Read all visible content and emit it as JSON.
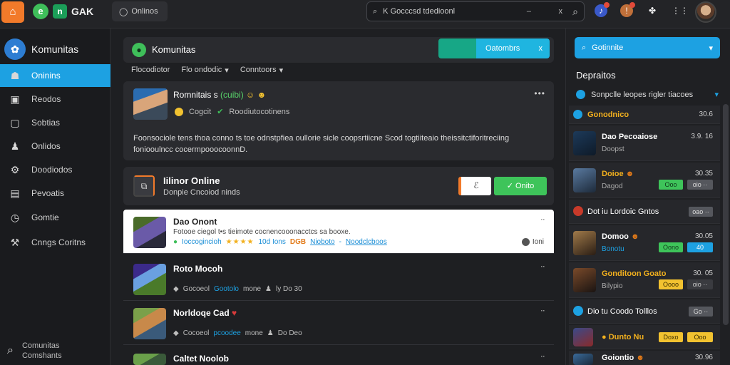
{
  "topbar": {
    "logo_glyph": "⌂",
    "brand_badge": "e",
    "brand_n": "n",
    "brand_name": "GAK",
    "tab_label": "Onlinos",
    "search_value": "K Gocccsd tdedioonl",
    "search_clear": "x",
    "search_dash": "–",
    "search_icon": "search-icon",
    "icons": [
      "notification-icon",
      "alert-icon",
      "puzzle-icon",
      "grid-icon"
    ]
  },
  "sidebar": {
    "title": "Komunitas",
    "items": [
      {
        "label": "Oninins",
        "icon": "home-icon"
      },
      {
        "label": "Reodos",
        "icon": "book-icon"
      },
      {
        "label": "Sobtias",
        "icon": "square-icon"
      },
      {
        "label": "Onlidos",
        "icon": "user-icon"
      },
      {
        "label": "Doodiodos",
        "icon": "settings-icon"
      },
      {
        "label": "Pevoatis",
        "icon": "doc-icon"
      },
      {
        "label": "Gomtie",
        "icon": "clock-icon"
      },
      {
        "label": "Cnngs Coritns",
        "icon": "wrench-icon"
      }
    ],
    "footer_lines": [
      "Comunitas",
      "Comshants"
    ]
  },
  "main": {
    "header_title": "Komunitas",
    "join_label": "Oatombrs",
    "join_close": "x",
    "filters": [
      "Flocodiotor",
      "Flo ondodic",
      "Conntoors"
    ],
    "post": {
      "title": "Romnitais s",
      "title_tag": "(cuibi)",
      "title_emoji": "☺ ☻",
      "sub_left": "Cogcit",
      "sub_right": "Roodiutocotinens",
      "body_line1": "Foonsociole tens thoa conno ts toe odnstpfiea oullorie sicle coopsrtiicne Scod togtiiteaio theissitctiforitreciing",
      "body_line2": "foniooulncc cocermpooocoonnD.",
      "kebab": "•••"
    },
    "online": {
      "title": "Iilinor Online",
      "subtitle": "Donpie Cncoiod ninds",
      "white_btn": "ℰ",
      "green_btn": "✓ Onito"
    },
    "rows": [
      {
        "name": "Dao Onont",
        "desc": "Fotooe ciegol t•s tieimote cocnencooonacctcs sa booxe.",
        "meta_left": "Ioccogincioh",
        "stars": "★★★★",
        "num": "10d Ions",
        "orange": "DGB",
        "link1": "Nioboto",
        "link2": "Noodclcboos",
        "time": "Ioni",
        "kebab": "⠒"
      },
      {
        "name": "Roto Mocoh",
        "meta_left": "Gocoeol",
        "meta_blue": "Gootolo",
        "meta_mid": "mone",
        "meta_right": "ly Do 30",
        "kebab": "⠒"
      },
      {
        "name": "Norldoqe Cad",
        "meta_left": "Cocoeol",
        "meta_blue": "pcoodee",
        "meta_mid": "mone",
        "meta_right": "Do Deo",
        "kebab": "⠒"
      },
      {
        "name": "Caltet Noolob",
        "kebab": "⠒"
      }
    ]
  },
  "right": {
    "search_label": "Gotinnite",
    "head": "Depraitos",
    "sub": "Sonpclle leopes rigler tiacoes",
    "items": [
      {
        "name": "Gonodnico",
        "val": "30.6",
        "sub": "",
        "pill": ""
      },
      {
        "name": "Dao Pecoaiose",
        "sub": "Doopst",
        "val": "3.9. 16",
        "pill": ""
      },
      {
        "name": "Doioe",
        "sub": "Dagod",
        "val": "30.35",
        "pill": "Ooo",
        "pill2": "oio ··"
      },
      {
        "name": "Dot iu Lordoic Gntos",
        "sub": "",
        "val": "",
        "pill": "oao ··"
      },
      {
        "name": "Domoo",
        "sub": "Bonotu",
        "val": "30.05",
        "pill": "Oono",
        "pill2": "40"
      },
      {
        "name": "Gonditoon Goato",
        "sub": "Bilypio",
        "val": "30. 05",
        "pill": "Oooo",
        "pill2": "oio ··"
      },
      {
        "name": "Dio tu Coodo Tolllos",
        "sub": "",
        "val": "",
        "pill": "Go ··"
      },
      {
        "name": "Dunto Nu",
        "sub": "",
        "val": "",
        "pill": "Doxo",
        "pill2": "Ooo"
      },
      {
        "name": "Goiontio",
        "sub": "",
        "val": "30.96",
        "pill": ""
      }
    ]
  },
  "colors": {
    "accent": "#1da1e2",
    "brand_orange": "#f27a2a",
    "success": "#3ec45a"
  }
}
